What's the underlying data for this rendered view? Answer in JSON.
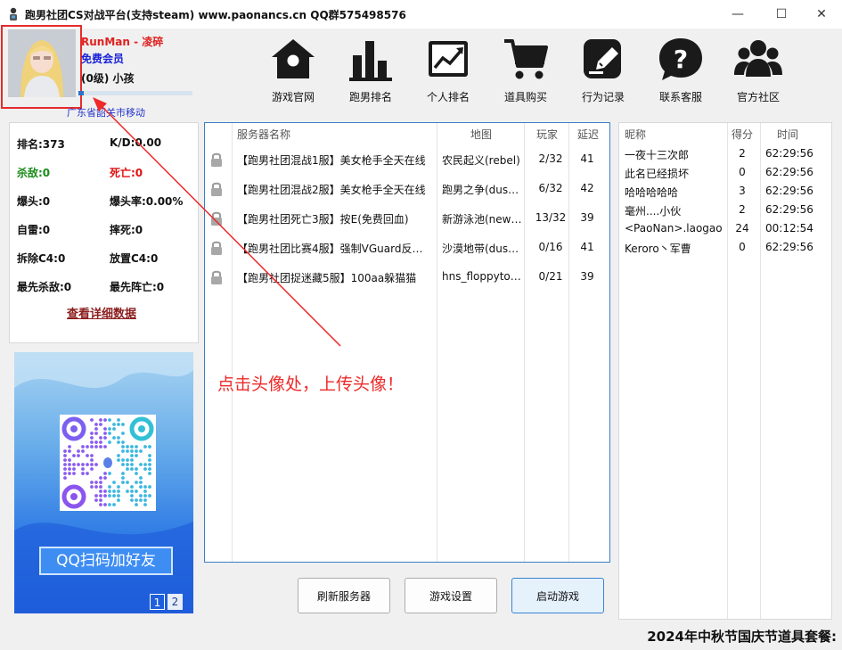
{
  "window": {
    "title": "跑男社团CS对战平台(支持steam) www.paonancs.cn QQ群575498576",
    "minimize": "—",
    "maximize": "☐",
    "close": "✕"
  },
  "profile": {
    "name": "RunMan - 凌碎",
    "membership": "免费会员",
    "level": "(0级) 小孩",
    "level_progress": 0.05,
    "location": "广东省韶关市移动"
  },
  "nav": [
    {
      "label": "游戏官网",
      "icon": "home-icon"
    },
    {
      "label": "跑男排名",
      "icon": "bar-chart-icon"
    },
    {
      "label": "个人排名",
      "icon": "trend-chart-icon"
    },
    {
      "label": "道具购买",
      "icon": "cart-icon"
    },
    {
      "label": "行为记录",
      "icon": "edit-icon"
    },
    {
      "label": "联系客服",
      "icon": "help-icon"
    },
    {
      "label": "官方社区",
      "icon": "community-icon"
    }
  ],
  "stats": {
    "rank": "排名:373",
    "kd": "K/D:0.00",
    "kills": "杀敌:0",
    "deaths": "死亡:0",
    "headshots": "爆头:0",
    "headshot_rate": "爆头率:0.00%",
    "grenade_kills": "自雷:0",
    "fall_deaths": "摔死:0",
    "defuse_c4": "拆除C4:0",
    "plant_c4": "放置C4:0",
    "first_kill": "最先杀敌:0",
    "first_death": "最先阵亡:0",
    "detail_link": "查看详细数据",
    "kills_color": "#1a8a1a",
    "deaths_color": "#e01010"
  },
  "ad": {
    "banner": "QQ扫码加好友",
    "pages": [
      "1",
      "2"
    ]
  },
  "servers": {
    "columns": [
      "服务器名称",
      "地图",
      "玩家",
      "延迟"
    ],
    "rows": [
      {
        "name": "【跑男社团混战1服】美女枪手全天在线",
        "map": "农民起义(rebel)",
        "players": "2/32",
        "ping": "41"
      },
      {
        "name": "【跑男社团混战2服】美女枪手全天在线",
        "map": "跑男之争(dust…",
        "players": "6/32",
        "ping": "42"
      },
      {
        "name": "【跑男社团死亡3服】按E(免费回血)",
        "map": "新游泳池(new…",
        "players": "13/32",
        "ping": "39"
      },
      {
        "name": "【跑男社团比赛4服】强制VGuard反作…",
        "map": "沙漠地带(dust…",
        "players": "0/16",
        "ping": "41"
      },
      {
        "name": "【跑男社团捉迷藏5服】100aa躲猫猫",
        "map": "hns_floppyto…",
        "players": "0/21",
        "ping": "39"
      }
    ]
  },
  "buttons": {
    "refresh": "刷新服务器",
    "settings": "游戏设置",
    "launch": "启动游戏"
  },
  "players": {
    "columns": [
      "昵称",
      "得分",
      "时间"
    ],
    "rows": [
      {
        "nick": "一夜十三次郎",
        "score": "2",
        "time": "62:29:56"
      },
      {
        "nick": "此名已经损坏",
        "score": "0",
        "time": "62:29:56"
      },
      {
        "nick": "哈哈哈哈哈",
        "score": "3",
        "time": "62:29:56"
      },
      {
        "nick": "毫州....小伙",
        "score": "2",
        "time": "62:29:56"
      },
      {
        "nick": "<PaoNan>.laogao",
        "score": "24",
        "time": "00:12:54"
      },
      {
        "nick": "Keroro丶军曹",
        "score": "0",
        "time": "62:29:56"
      }
    ]
  },
  "promo": "2024年中秋节国庆节道具套餐:",
  "annotation": "点击头像处，上传头像！",
  "colors": {
    "accent": "#3a7fc3",
    "annotation_red": "#ee2a2a"
  }
}
